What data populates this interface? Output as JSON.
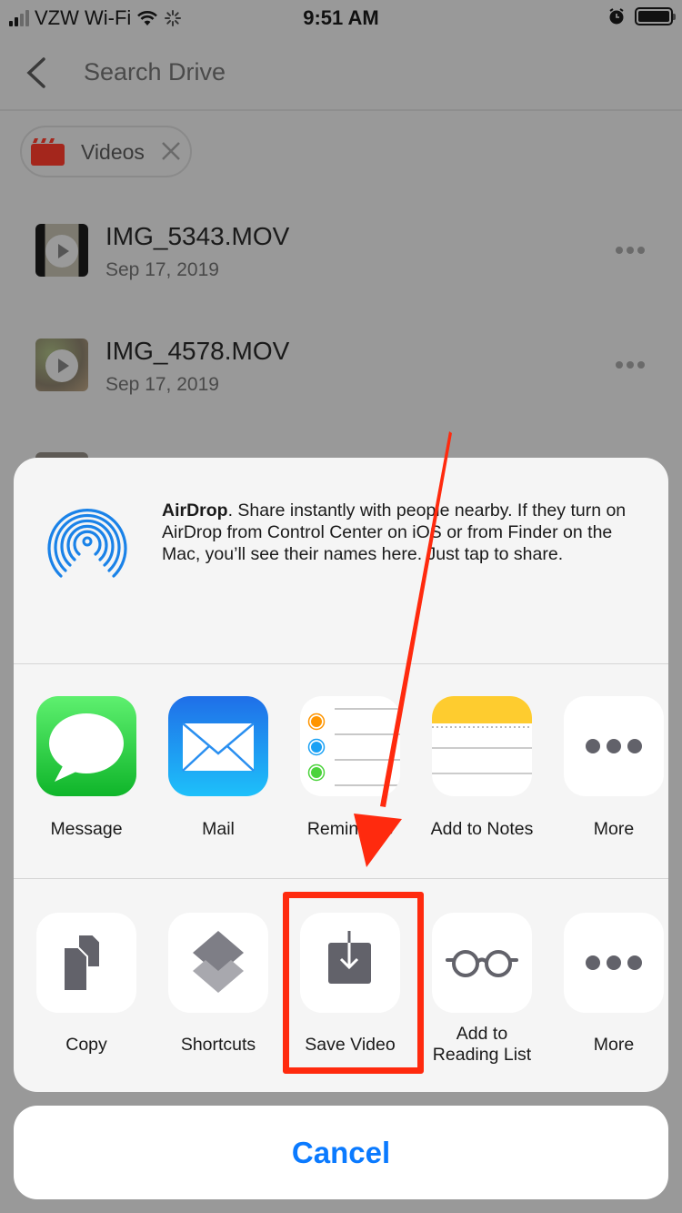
{
  "status_bar": {
    "carrier": "VZW Wi-Fi",
    "time": "9:51 AM",
    "icons": [
      "signal-icon",
      "wifi-icon",
      "activity-spinner-icon",
      "alarm-icon",
      "battery-icon"
    ]
  },
  "header": {
    "back_icon": "chevron-left-icon",
    "search_placeholder": "Search Drive"
  },
  "filter_chip": {
    "icon": "clapperboard-icon",
    "label": "Videos",
    "remove_icon": "close-icon",
    "icon_color": "#a4261c"
  },
  "files": [
    {
      "name": "IMG_5343.MOV",
      "date": "Sep 17, 2019",
      "thumbnail_icon": "video-thumbnail",
      "menu_icon": "more-horizontal-icon"
    },
    {
      "name": "IMG_4578.MOV",
      "date": "Sep 17, 2019",
      "thumbnail_icon": "video-thumbnail",
      "menu_icon": "more-horizontal-icon"
    }
  ],
  "share_sheet": {
    "airdrop": {
      "title": "AirDrop",
      "description": ". Share instantly with people nearby. If they turn on AirDrop from Control Center on iOS or from Finder on the Mac, you’ll see their names here. Just tap to share.",
      "icon": "airdrop-icon",
      "color": "#1a82e8"
    },
    "apps": [
      {
        "label": "Message",
        "icon": "messages-icon"
      },
      {
        "label": "Mail",
        "icon": "mail-icon"
      },
      {
        "label": "Reminders",
        "icon": "reminders-icon"
      },
      {
        "label": "Add to Notes",
        "icon": "notes-icon"
      },
      {
        "label": "More",
        "icon": "more-icon"
      }
    ],
    "actions": [
      {
        "label": "Copy",
        "icon": "copy-icon"
      },
      {
        "label": "Shortcuts",
        "icon": "shortcuts-icon"
      },
      {
        "label": "Save Video",
        "icon": "save-download-icon"
      },
      {
        "label_line1": "Add to",
        "label_line2": "Reading List",
        "icon": "reading-glasses-icon"
      },
      {
        "label": "More",
        "icon": "more-icon"
      }
    ],
    "cancel_label": "Cancel",
    "accent_color": "#0a7aff"
  },
  "annotation": {
    "highlight_target": "Save Video",
    "color": "#ff2a0e"
  }
}
